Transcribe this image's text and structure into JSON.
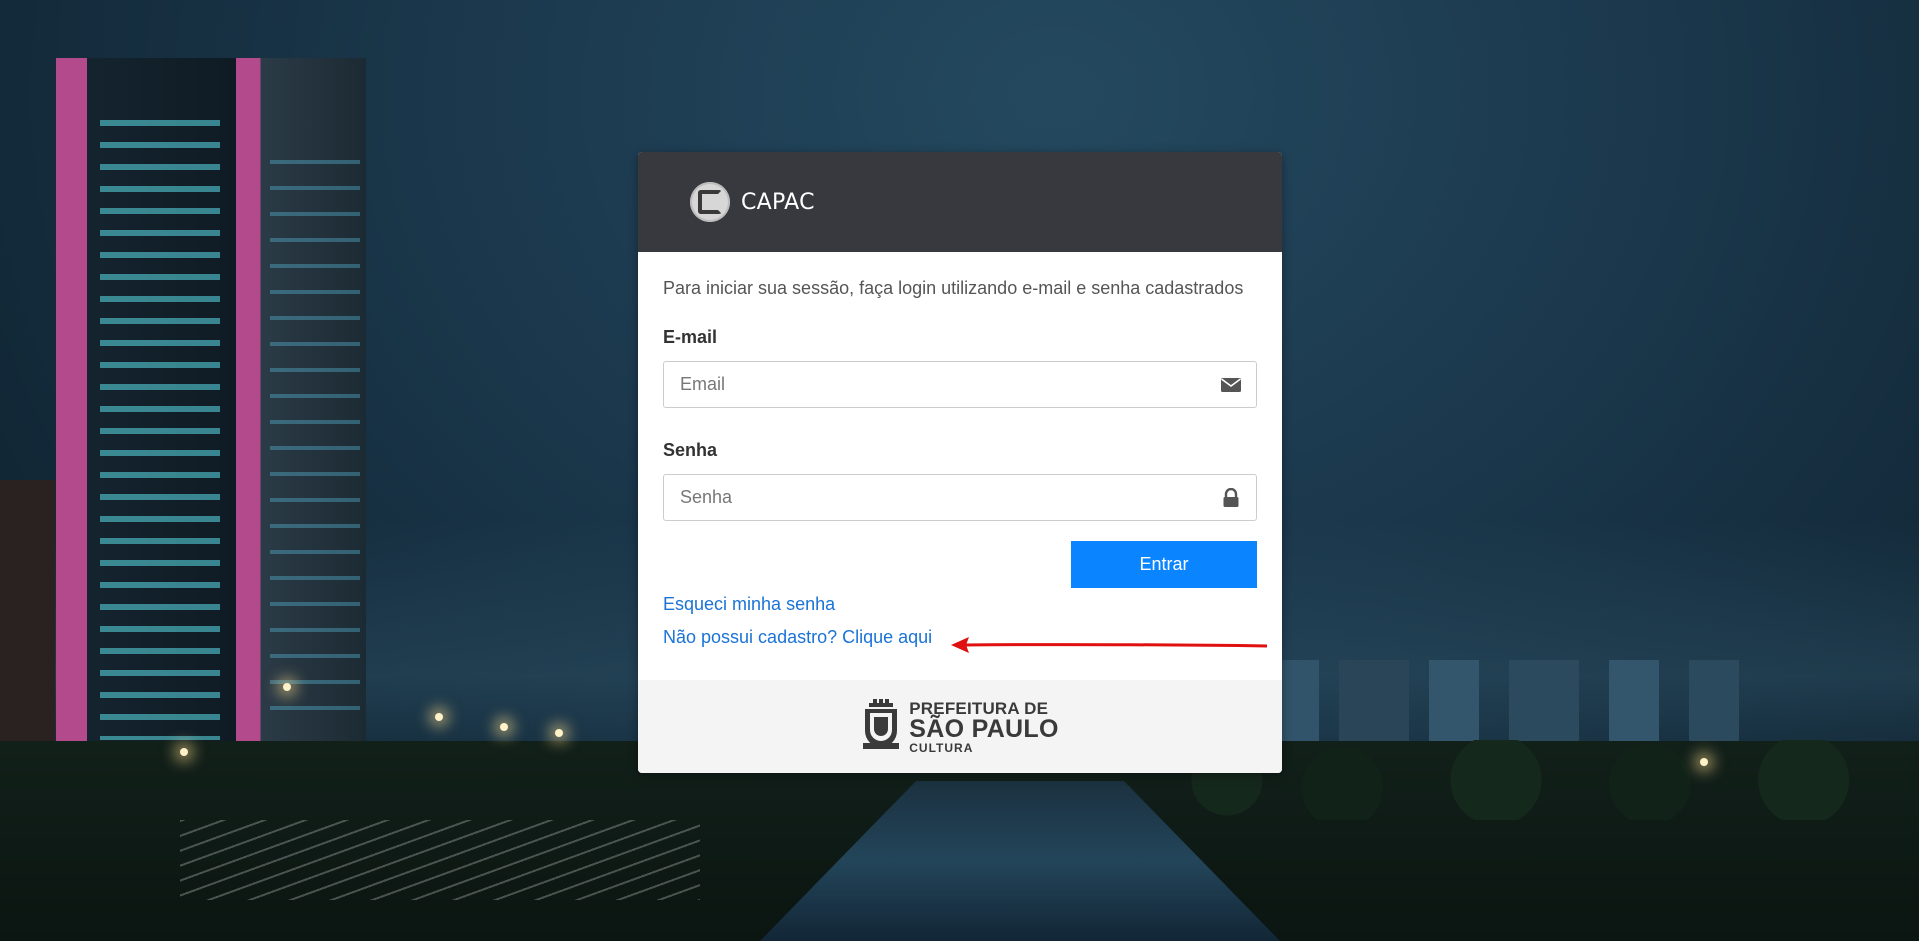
{
  "header": {
    "brand": "CAPAC"
  },
  "login": {
    "intro": "Para iniciar sua sessão, faça login utilizando e-mail e senha cadastrados",
    "email": {
      "label": "E-mail",
      "placeholder": "Email",
      "value": "",
      "icon": "envelope-icon"
    },
    "password": {
      "label": "Senha",
      "placeholder": "Senha",
      "value": "",
      "icon": "lock-icon"
    },
    "submit_label": "Entrar",
    "forgot_link": "Esqueci minha senha",
    "register_link": "Não possui cadastro? Clique aqui"
  },
  "footer": {
    "org_line1": "PREFEITURA DE",
    "org_line2": "SÃO PAULO",
    "org_line3": "CULTURA"
  },
  "colors": {
    "header_bg": "#37393e",
    "button_bg": "#0a84ff",
    "link": "#1a73d6",
    "annotation_arrow": "#e01010"
  }
}
